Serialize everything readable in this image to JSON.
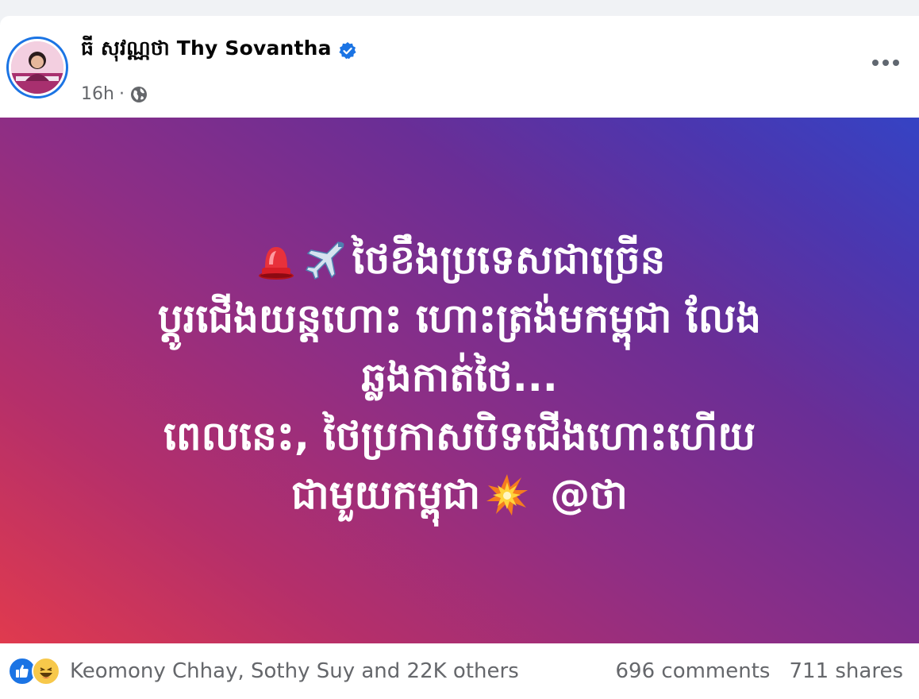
{
  "post": {
    "author_name": "ធី សុវណ្ណថា Thy Sovantha",
    "time": "16h",
    "separator": "·",
    "privacy_icon": "globe-icon",
    "verified_icon": "verified-badge-icon",
    "more_icon": "more-options-icon"
  },
  "banner": {
    "line1": "ថៃខឹងប្រទេសជាច្រើន",
    "line2": "ប្តូរជើងយន្តហោះ ហោះត្រង់មកម្ពុជា លែង",
    "line3": "ឆ្លងកាត់ថៃ...",
    "line4": "ពេលនេះ, ថៃប្រកាសបិទជើងហោះហើយ",
    "line5_text": "ជាមួយកម្ពុជា",
    "line5_tag": "@ថា",
    "emoji_1": "police-light-emoji",
    "emoji_2": "airplane-emoji",
    "emoji_3": "collision-emoji",
    "colors": {
      "start": "#e03a4e",
      "middle": "#8e2e85",
      "end": "#3543c4"
    }
  },
  "footer": {
    "reactions_text": "Keomony Chhay, Sothy Suy and 22K others",
    "comments": "696 comments",
    "shares": "711 shares",
    "reaction_icons": [
      "like-icon",
      "haha-icon"
    ]
  }
}
